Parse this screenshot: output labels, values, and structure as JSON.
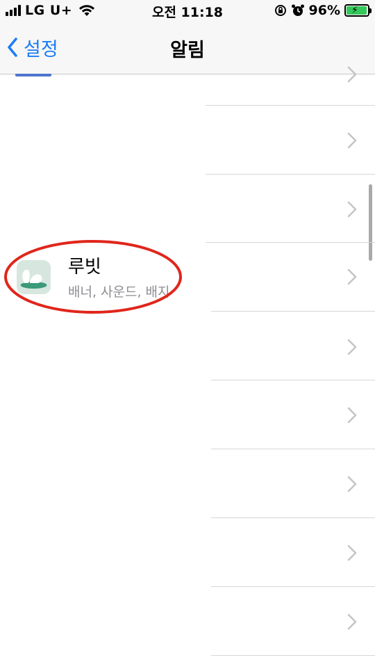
{
  "status_bar": {
    "carrier": "LG U+",
    "time": "오전 11:18",
    "battery_percent": "96%",
    "battery_level": 0.96,
    "signal_bars": 4,
    "charging": true
  },
  "nav": {
    "back_label": "설정",
    "title": "알림"
  },
  "app": {
    "name": "루빗",
    "subtitle": "배너, 사운드, 배지"
  },
  "colors": {
    "accent": "#1b7cf5",
    "highlight": "#e0261b",
    "battery": "#34c759"
  },
  "icons": {
    "back": "chevron-left-icon",
    "row": "chevron-right-icon",
    "wifi": "wifi-icon",
    "orientation_lock": "orientation-lock-icon",
    "alarm": "alarm-clock-icon"
  }
}
